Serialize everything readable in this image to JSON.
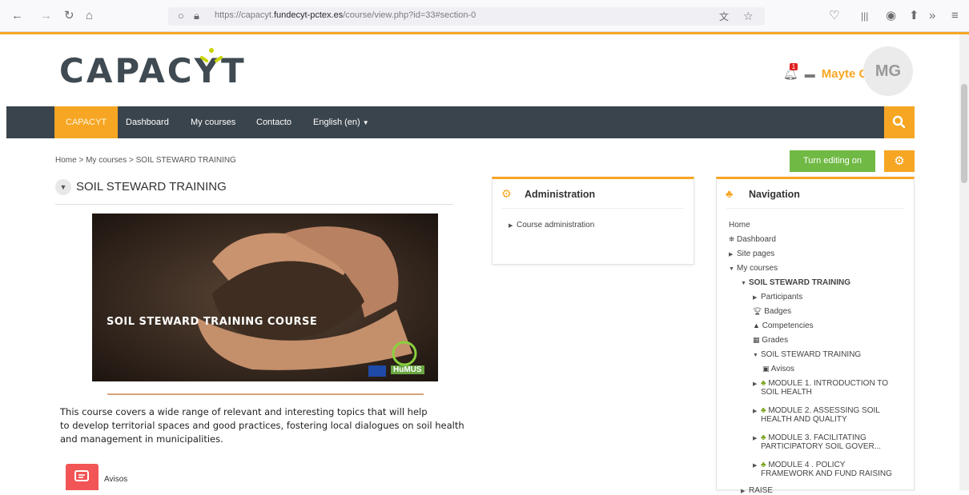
{
  "browser": {
    "url_prefix": "https://capacyt.",
    "url_domain": "fundecyt-pctex.es",
    "url_path": "/course/view.php?id=33#section-0"
  },
  "site": {
    "logo_text": "CAPACYT",
    "user_name": "Mayte Gallego",
    "avatar_initials": "MG",
    "notification_count": "1"
  },
  "nav": {
    "items": [
      "CAPACYT",
      "Dashboard",
      "My courses",
      "Contacto",
      "English (en)"
    ]
  },
  "breadcrumb": {
    "home": "Home",
    "my_courses": "My courses",
    "course": "SOIL STEWARD TRAINING"
  },
  "buttons": {
    "turn_editing": "Turn editing on"
  },
  "course": {
    "title": "SOIL STEWARD TRAINING",
    "hero_caption": "SOIL STEWARD TRAINING COURSE",
    "hero_brand": "HuMUS",
    "description_line1": "This course covers a wide range of relevant and interesting topics that will help",
    "description_line2": "to develop territorial spaces and good practices, fostering local dialogues on soil health",
    "description_line3": "and management in municipalities.",
    "avisos": "Avisos"
  },
  "admin_block": {
    "title": "Administration",
    "item": "Course administration"
  },
  "nav_block": {
    "title": "Navigation",
    "home": "Home",
    "dashboard": "Dashboard",
    "site_pages": "Site pages",
    "my_courses": "My courses",
    "course": "SOIL STEWARD TRAINING",
    "participants": "Participants",
    "badges": "Badges",
    "competencies": "Competencies",
    "grades": "Grades",
    "section": "SOIL STEWARD TRAINING",
    "avisos": "Avisos",
    "m1_a": "MODULE 1. INTRODUCTION TO",
    "m1_b": "SOIL HEALTH",
    "m2_a": "MODULE 2. ASSESSING SOIL",
    "m2_b": "HEALTH AND QUALITY",
    "m3_a": "MODULE 3. FACILITATING",
    "m3_b": "PARTICIPATORY SOIL GOVER...",
    "m4_a": "MODULE 4 . POLICY",
    "m4_b": "FRAMEWORK AND FUND RAISING",
    "more": "RAISE"
  },
  "colors": {
    "accent": "#f6a623",
    "navbar": "#3a444c",
    "edit_button": "#70b944",
    "avisos": "#f25555"
  }
}
